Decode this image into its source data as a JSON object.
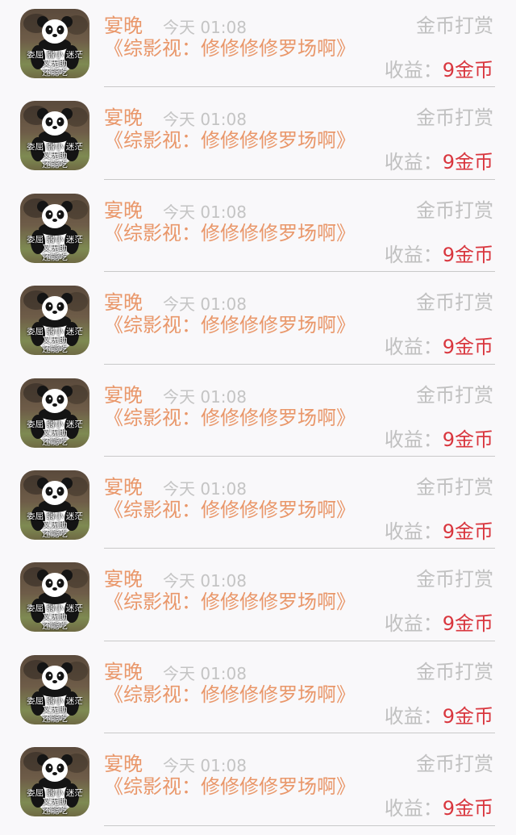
{
  "items": [
    {
      "author": "宴晚",
      "time": "今天 01:08",
      "title": "《综影视：修修修修罗场啊》",
      "tip": "金币打赏",
      "earn_label": "收益：",
      "earn_value": "9金币",
      "avatar_caption": [
        "委屈 弱小 迷茫",
        "又无助",
        "还能吃"
      ]
    },
    {
      "author": "宴晚",
      "time": "今天 01:08",
      "title": "《综影视：修修修修罗场啊》",
      "tip": "金币打赏",
      "earn_label": "收益：",
      "earn_value": "9金币",
      "avatar_caption": [
        "委屈 弱小 迷茫",
        "又无助",
        "还能吃"
      ]
    },
    {
      "author": "宴晚",
      "time": "今天 01:08",
      "title": "《综影视：修修修修罗场啊》",
      "tip": "金币打赏",
      "earn_label": "收益：",
      "earn_value": "9金币",
      "avatar_caption": [
        "委屈 弱小 迷茫",
        "又无助",
        "还能吃"
      ]
    },
    {
      "author": "宴晚",
      "time": "今天 01:08",
      "title": "《综影视：修修修修罗场啊》",
      "tip": "金币打赏",
      "earn_label": "收益：",
      "earn_value": "9金币",
      "avatar_caption": [
        "委屈 弱小 迷茫",
        "又无助",
        "还能吃"
      ]
    },
    {
      "author": "宴晚",
      "time": "今天 01:08",
      "title": "《综影视：修修修修罗场啊》",
      "tip": "金币打赏",
      "earn_label": "收益：",
      "earn_value": "9金币",
      "avatar_caption": [
        "委屈 弱小 迷茫",
        "又无助",
        "还能吃"
      ]
    },
    {
      "author": "宴晚",
      "time": "今天 01:08",
      "title": "《综影视：修修修修罗场啊》",
      "tip": "金币打赏",
      "earn_label": "收益：",
      "earn_value": "9金币",
      "avatar_caption": [
        "委屈 弱小 迷茫",
        "又无助",
        "还能吃"
      ]
    },
    {
      "author": "宴晚",
      "time": "今天 01:08",
      "title": "《综影视：修修修修罗场啊》",
      "tip": "金币打赏",
      "earn_label": "收益：",
      "earn_value": "9金币",
      "avatar_caption": [
        "委屈 弱小 迷茫",
        "又无助",
        "还能吃"
      ]
    },
    {
      "author": "宴晚",
      "time": "今天 01:08",
      "title": "《综影视：修修修修罗场啊》",
      "tip": "金币打赏",
      "earn_label": "收益：",
      "earn_value": "9金币",
      "avatar_caption": [
        "委屈 弱小 迷茫",
        "又无助",
        "还能吃"
      ]
    },
    {
      "author": "宴晚",
      "time": "今天 01:08",
      "title": "《综影视：修修修修罗场啊》",
      "tip": "金币打赏",
      "earn_label": "收益：",
      "earn_value": "9金币",
      "avatar_caption": [
        "委屈 弱小 迷茫",
        "又无助",
        "还能吃"
      ]
    }
  ],
  "colors": {
    "author": "#e9976a",
    "title": "#e9976a",
    "muted": "#c0c0c0",
    "earn_value": "#d9363e",
    "background": "#f9f8fa"
  },
  "icons": {
    "avatar": "panda-avatar-icon"
  }
}
